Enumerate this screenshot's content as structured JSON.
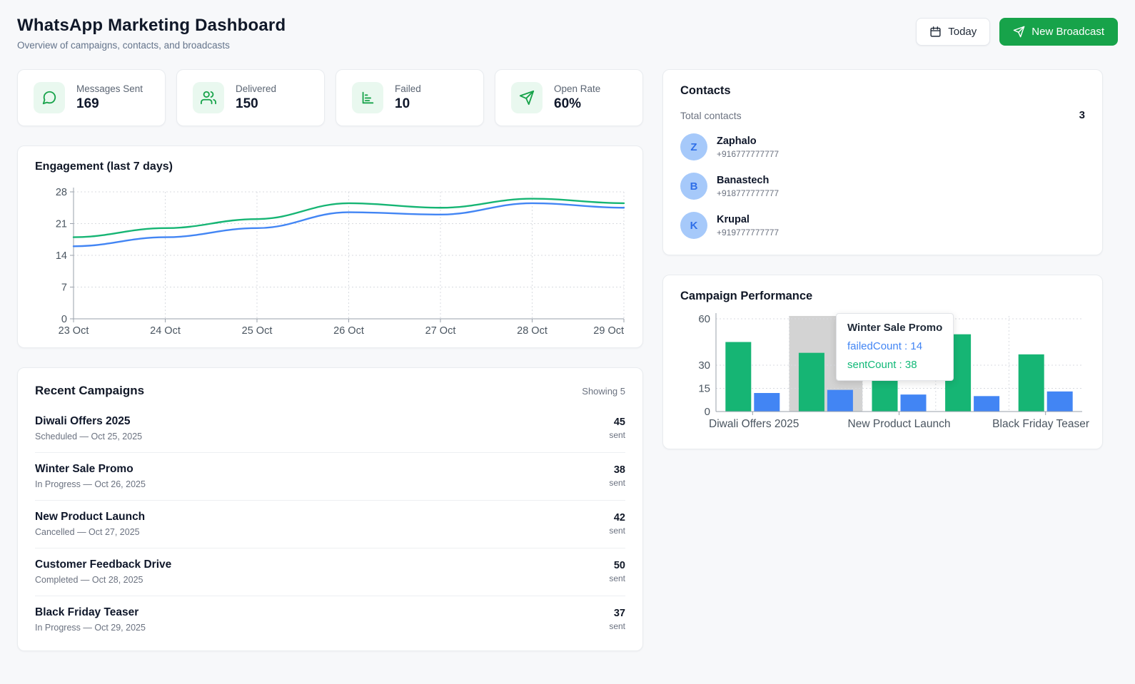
{
  "header": {
    "title": "WhatsApp Marketing Dashboard",
    "subtitle": "Overview of campaigns, contacts, and broadcasts",
    "today_button": "Today",
    "new_broadcast_button": "New Broadcast"
  },
  "stats": [
    {
      "icon": "message-icon",
      "label": "Messages Sent",
      "value": "169"
    },
    {
      "icon": "users-icon",
      "label": "Delivered",
      "value": "150"
    },
    {
      "icon": "bar-chart-icon",
      "label": "Failed",
      "value": "10"
    },
    {
      "icon": "send-icon",
      "label": "Open Rate",
      "value": "60%"
    }
  ],
  "engagement": {
    "title": "Engagement (last 7 days)"
  },
  "recent_campaigns": {
    "title": "Recent Campaigns",
    "showing": "Showing 5",
    "items": [
      {
        "name": "Diwali Offers 2025",
        "status": "Scheduled — Oct 25, 2025",
        "count": "45",
        "unit": "sent"
      },
      {
        "name": "Winter Sale Promo",
        "status": "In Progress — Oct 26, 2025",
        "count": "38",
        "unit": "sent"
      },
      {
        "name": "New Product Launch",
        "status": "Cancelled — Oct 27, 2025",
        "count": "42",
        "unit": "sent"
      },
      {
        "name": "Customer Feedback Drive",
        "status": "Completed — Oct 28, 2025",
        "count": "50",
        "unit": "sent"
      },
      {
        "name": "Black Friday Teaser",
        "status": "In Progress — Oct 29, 2025",
        "count": "37",
        "unit": "sent"
      }
    ]
  },
  "contacts": {
    "title": "Contacts",
    "total_label": "Total contacts",
    "total_value": "3",
    "items": [
      {
        "initial": "Z",
        "name": "Zaphalo",
        "phone": "+916777777777"
      },
      {
        "initial": "B",
        "name": "Banastech",
        "phone": "+918777777777"
      },
      {
        "initial": "K",
        "name": "Krupal",
        "phone": "+919777777777"
      }
    ]
  },
  "campaign_performance": {
    "title": "Campaign Performance",
    "tooltip": {
      "title": "Winter Sale Promo",
      "failed_line": "failedCount : 14",
      "sent_line": "sentCount : 38"
    }
  },
  "colors": {
    "accent_green": "#17a34a",
    "chart_green": "#16b574",
    "chart_blue": "#4285f4",
    "grid": "#d8dbe0",
    "axis": "#9aa1ab",
    "axis_text": "#4a5560",
    "hover_band": "#d3d3d3"
  },
  "chart_data": [
    {
      "type": "line",
      "title": "Engagement (last 7 days)",
      "x": [
        "23 Oct",
        "24 Oct",
        "25 Oct",
        "26 Oct",
        "27 Oct",
        "28 Oct",
        "29 Oct"
      ],
      "yticks": [
        0,
        7,
        14,
        21,
        28
      ],
      "ylim": [
        0,
        28
      ],
      "grid": "dashed",
      "legend": "none",
      "series": [
        {
          "name": "green",
          "color_key": "chart_green",
          "values": [
            18,
            20,
            22,
            25.5,
            24.5,
            26.5,
            25.5
          ]
        },
        {
          "name": "blue",
          "color_key": "chart_blue",
          "values": [
            16,
            18,
            20,
            23.5,
            23,
            25.5,
            24.5
          ]
        }
      ]
    },
    {
      "type": "bar",
      "title": "Campaign Performance",
      "categories": [
        "Diwali Offers 2025",
        "Winter Sale Promo",
        "New Product Launch",
        "Customer Feedback Drive",
        "Black Friday Teaser"
      ],
      "shown_category_labels": [
        "Diwali Offers 2025",
        "New Product Launch",
        "Black Friday Teaser"
      ],
      "labeled_indices": [
        0,
        2,
        4
      ],
      "yticks": [
        0,
        15,
        30,
        60
      ],
      "ylim": [
        0,
        60
      ],
      "grid": "dashed",
      "highlighted_category_index": 1,
      "series": [
        {
          "name": "sentCount",
          "color_key": "chart_green",
          "values": [
            45,
            38,
            42,
            50,
            37
          ]
        },
        {
          "name": "failedCount",
          "color_key": "chart_blue",
          "values": [
            12,
            14,
            11,
            10,
            13
          ]
        }
      ]
    }
  ]
}
